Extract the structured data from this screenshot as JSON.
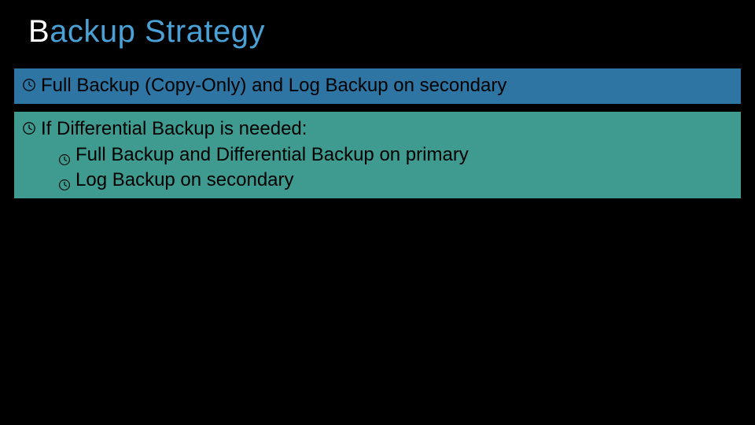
{
  "title": {
    "accent": "B",
    "rest": "ackup Strategy"
  },
  "blocks": [
    {
      "text": "Full Backup (Copy-Only) and Log Backup on secondary"
    },
    {
      "text": "If Differential Backup is needed:",
      "subitems": [
        "Full Backup and Differential Backup on primary",
        "Log Backup on secondary"
      ]
    }
  ]
}
